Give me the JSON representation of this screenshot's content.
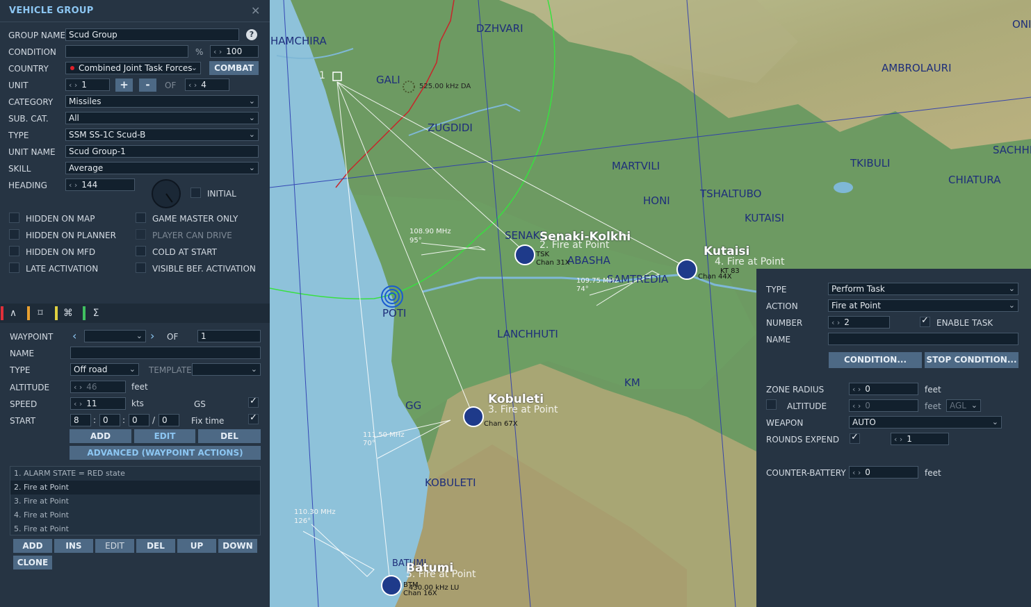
{
  "panel": {
    "title": "VEHICLE GROUP",
    "close_icon": "close-icon",
    "group_name_label": "GROUP NAME",
    "group_name": "Scud Group",
    "help_label": "?",
    "condition_label": "CONDITION",
    "condition_value": "",
    "percent_label": "%",
    "condition_percent": "100",
    "country_label": "COUNTRY",
    "country": "Combined Joint Task Forces",
    "country_color": "#e0202a",
    "combat_label": "COMBAT",
    "unit_label": "UNIT",
    "unit_value": "1",
    "plus_label": "+",
    "minus_label": "-",
    "of_label": "OF",
    "unit_total": "4",
    "category_label": "CATEGORY",
    "category": "Missiles",
    "subcat_label": "SUB. CAT.",
    "subcat": "All",
    "type_label": "TYPE",
    "type": "SSM SS-1C Scud-B",
    "unit_name_label": "UNIT NAME",
    "unit_name": "Scud Group-1",
    "skill_label": "SKILL",
    "skill": "Average",
    "heading_label": "HEADING",
    "heading": "144",
    "heading_deg": 144,
    "initial_label": "INITIAL",
    "checkboxes": [
      {
        "label": "HIDDEN ON MAP",
        "checked": false,
        "enabled": true
      },
      {
        "label": "GAME MASTER ONLY",
        "checked": false,
        "enabled": true
      },
      {
        "label": "HIDDEN ON PLANNER",
        "checked": false,
        "enabled": true
      },
      {
        "label": "PLAYER CAN DRIVE",
        "checked": false,
        "enabled": false
      },
      {
        "label": "HIDDEN ON MFD",
        "checked": false,
        "enabled": true
      },
      {
        "label": "COLD AT START",
        "checked": false,
        "enabled": true
      },
      {
        "label": "LATE ACTIVATION",
        "checked": false,
        "enabled": true
      },
      {
        "label": "VISIBLE BEF. ACTIVATION",
        "checked": false,
        "enabled": true
      }
    ]
  },
  "tabs": [
    {
      "icon": "route-icon",
      "glyph": "∧",
      "stripe": "#e0303a"
    },
    {
      "icon": "target-icon",
      "glyph": "⌑",
      "stripe": "#e8a030"
    },
    {
      "icon": "command-icon",
      "glyph": "⌘",
      "stripe": "#e0d040"
    },
    {
      "icon": "sigma-icon",
      "glyph": "Σ",
      "stripe": "#40c060"
    }
  ],
  "waypoint": {
    "waypoint_label": "WAYPOINT",
    "waypoint_value": "",
    "of_label": "OF",
    "of_value": "1",
    "name_label": "NAME",
    "name_value": "",
    "type_label": "TYPE",
    "type_value": "Off road",
    "template_label": "TEMPLATE",
    "template_value": "",
    "altitude_label": "ALTITUDE",
    "altitude_value": "46",
    "feet_label": "feet",
    "speed_label": "SPEED",
    "speed_value": "11",
    "kts_label": "kts",
    "gs_label": "GS",
    "start_label": "START",
    "start_d": "8",
    "start_h": "0",
    "start_m": "0",
    "start_s": "0",
    "colon": ":",
    "slash": "/",
    "fix_time_label": "Fix time",
    "add_label": "ADD",
    "edit_label": "EDIT",
    "del_label": "DEL",
    "advanced_label": "ADVANCED (WAYPOINT ACTIONS)"
  },
  "actions": {
    "items": [
      "1. ALARM STATE = RED state",
      "2. Fire at Point",
      "3. Fire at Point",
      "4. Fire at Point",
      "5. Fire at Point"
    ],
    "buttons": [
      "ADD",
      "INS",
      "EDIT",
      "DEL",
      "UP",
      "DOWN"
    ],
    "clone_label": "CLONE"
  },
  "task": {
    "type_label": "TYPE",
    "type_value": "Perform Task",
    "action_label": "ACTION",
    "action_value": "Fire at Point",
    "number_label": "NUMBER",
    "number_value": "2",
    "enable_task_label": "ENABLE TASK",
    "name_label": "NAME",
    "name_value": "",
    "condition_btn": "CONDITION...",
    "stop_condition_btn": "STOP CONDITION...",
    "zone_radius_label": "ZONE RADIUS",
    "zone_radius_value": "0",
    "feet_label": "feet",
    "altitude_label": "ALTITUDE",
    "altitude_value": "0",
    "agl_value": "AGL",
    "weapon_label": "WEAPON",
    "weapon_value": "AUTO",
    "rounds_label": "ROUNDS EXPEND",
    "rounds_value": "1",
    "counter_battery_label": "COUNTER-BATTERY",
    "counter_battery_value": "0"
  },
  "map": {
    "places": [
      "HAMCHIRA",
      "DZHVARI",
      "GALI",
      "ZUGDIDI",
      "AMBROLAURI",
      "ONI",
      "MARTVILI",
      "TKIBULI",
      "SACHHE",
      "CHIATURA",
      "HONI",
      "TSHALTUBO",
      "KUTAISI",
      "SENAKI",
      "ABASHA",
      "SAMTREDIA",
      "POTI",
      "LANCHHUTI",
      "KM",
      "GG",
      "KOBULETI",
      "BATUMI"
    ],
    "airfields": [
      "Senaki-Kolkhi",
      "Kutaisi",
      "Kobuleti",
      "Batumi"
    ],
    "waypoint_labels": [
      "1",
      "2. Fire at Point",
      "3. Fire at Point",
      "4. Fire at Point",
      "5. Fire at Point"
    ],
    "nav_info": [
      "525.00 kHz DA",
      "108.90 MHz",
      "95°",
      "109.75 MHz",
      "74°",
      "111.50 MHz",
      "70°",
      "110.30 MHz",
      "126°",
      "TSK",
      "Chan 31X",
      "Chan 44X",
      "Chan 67X",
      "Chan 16X",
      "KT 83",
      "430.00 kHz LU",
      "BTM"
    ]
  }
}
